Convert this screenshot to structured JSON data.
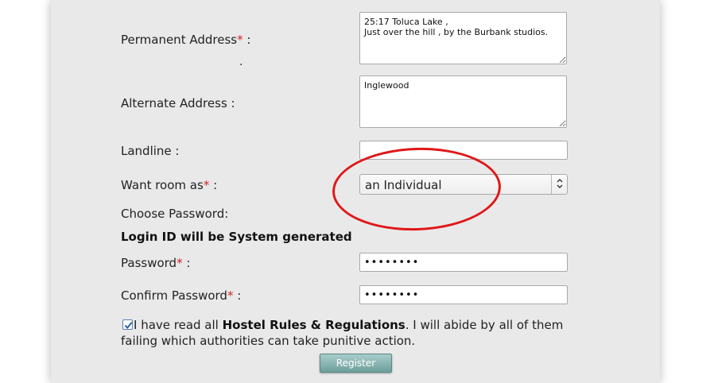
{
  "form": {
    "permanent_address": {
      "label": "Permanent Address",
      "required_mark": "*",
      "suffix": " :",
      "value": "25:17 Toluca Lake ,\nJust over the hill , by the Burbank studios.",
      "stray_text": "."
    },
    "alternate_address": {
      "label": "Alternate Address :",
      "value": "Inglewood"
    },
    "landline": {
      "label": "Landline :",
      "value": ""
    },
    "room_type": {
      "label": "Want room as",
      "required_mark": "*",
      "suffix": " :",
      "selected": "an Individual"
    },
    "choose_password_label": "Choose Password:",
    "login_note": "Login ID will be System generated",
    "password": {
      "label": "Password",
      "required_mark": "*",
      "suffix": " :",
      "value": "••••••••"
    },
    "confirm_password": {
      "label": "Confirm Password",
      "required_mark": "*",
      "suffix": " :",
      "value": "••••••••"
    },
    "agreement": {
      "checked": true,
      "text_before": "I have read all ",
      "bold": "Hostel Rules & Regulations",
      "text_after": ". I will abide by all of them failing which authorities can take punitive action."
    },
    "register_label": "Register"
  },
  "colors": {
    "required": "#d62222",
    "annotation_circle": "#e01818",
    "button": "#7fada9",
    "panel": "#e9e9ea"
  },
  "icons": {
    "select_arrow": "up-down-chevron-icon",
    "checkbox": "checkmark-icon"
  }
}
